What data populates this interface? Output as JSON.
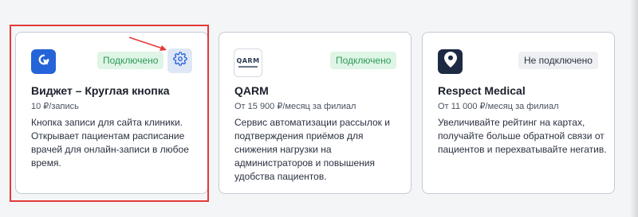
{
  "cards": [
    {
      "title": "Виджет – Круглая кнопка",
      "price": "10 ₽/запись",
      "status": "Подключено",
      "description": "Кнопка записи для сайта клиники. Открывает пациентам расписание врачей для онлайн-записи в любое время.",
      "logo_icon": "cursor-click-icon",
      "has_settings": true,
      "selected": true
    },
    {
      "title": "QARM",
      "price": "От 15 900 ₽/месяц за филиал",
      "status": "Подключено",
      "description": "Сервис автоматизации рассылок и подтверждения приёмов для снижения нагрузки на администраторов и повышения удобства пациентов.",
      "logo_text": "QARM"
    },
    {
      "title": "Respect Medical",
      "price": "От 11 000 ₽/месяц за филиал",
      "status": "Не подключено",
      "description": "Увеличивайте рейтинг на картах, получайте больше обратной связи от пациентов и перехватывайте негатив.",
      "logo_icon": "map-pin-icon"
    }
  ],
  "colors": {
    "accent": "#2563d8",
    "connected_bg": "#dff5e6",
    "connected_text": "#2e9a5a",
    "highlight": "#e33a3a"
  }
}
